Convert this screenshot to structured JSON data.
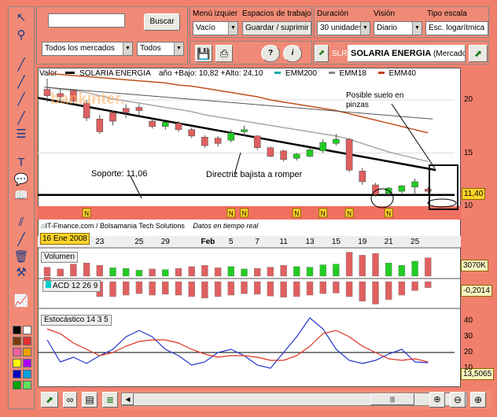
{
  "search": {
    "value": "",
    "button": "Buscar",
    "markets": "Todos los mercados",
    "filter": "Todos"
  },
  "menu": {
    "left_label": "Menú izquier",
    "left_value": "Vacío",
    "spaces_label": "Espacios de trabajo",
    "spaces_value": "Guardar / suprimir",
    "duration_label": "Duración",
    "duration_value": "30 unidades",
    "vision_label": "Visión",
    "vision_value": "Diario",
    "scale_label": "Tipo escala",
    "scale_value": "Esc. logarítmica"
  },
  "ticker": {
    "code": "SLR",
    "name": "SOLARIA ENERGIA",
    "market": "(Mercado"
  },
  "chart_header": {
    "valor": "Valor",
    "name": "SOLARIA ENERGIA",
    "range": "año +Bajo: 10,82 +Alto: 24,10",
    "emm200": "EMM200",
    "emm18": "EMM18",
    "emm40": "EMM40"
  },
  "annotations": {
    "suelo": "Posible suelo en pinzas",
    "soporte": "Soporte: 11,06",
    "directriz": "Directriz bajista a romper"
  },
  "watermark": "bankinter.",
  "footer_source": "IT-Finance.com / Bolsamania Tech Solutions",
  "footer_realtime": "Datos en tiempo real",
  "price_tag": "11,40",
  "date_tag": "16 Ene 2008",
  "x_labels": [
    "23",
    "25",
    "29",
    "Feb",
    "5",
    "7",
    "11",
    "13",
    "15",
    "19",
    "21",
    "25"
  ],
  "price_ticks": [
    "20",
    "15",
    "10"
  ],
  "news_flags": [
    "N",
    "N",
    "N",
    "N",
    "N",
    "N",
    "N"
  ],
  "volume": {
    "title": "Volumen",
    "tag": "3070K"
  },
  "macd": {
    "title": "ACD 12 26 9",
    "tag": "-0,2014"
  },
  "stoch": {
    "title": "Estocástico 14 3 5",
    "tag": "13,5065",
    "ticks": [
      "40",
      "30",
      "20",
      "10"
    ]
  },
  "colors": {
    "up": "#22cc22",
    "down": "#e06060",
    "ema18": "#a8a8a8",
    "ema40": "#c05020",
    "k": "#2233cc",
    "d": "#dd3322",
    "bg": "#f07f6c"
  },
  "tools": [
    "cursor-icon",
    "zoom-icon",
    "line-icon",
    "line-icon",
    "line-icon",
    "line-icon",
    "fib-icon",
    "text-icon",
    "comment-icon",
    "book-icon",
    "parallel-icon",
    "line-icon",
    "trash-icon",
    "tools-icon",
    "chart-icon"
  ],
  "chart_data": [
    {
      "type": "candlestick",
      "x": [
        "2008-01-16",
        "2008-01-17",
        "2008-01-18",
        "2008-01-21",
        "2008-01-22",
        "2008-01-23",
        "2008-01-24",
        "2008-01-25",
        "2008-01-28",
        "2008-01-29",
        "2008-01-30",
        "2008-01-31",
        "2008-02-01",
        "2008-02-04",
        "2008-02-05",
        "2008-02-06",
        "2008-02-07",
        "2008-02-08",
        "2008-02-11",
        "2008-02-12",
        "2008-02-13",
        "2008-02-14",
        "2008-02-15",
        "2008-02-18",
        "2008-02-19",
        "2008-02-20",
        "2008-02-21",
        "2008-02-22",
        "2008-02-25",
        "2008-02-26"
      ],
      "open": [
        21.0,
        20.6,
        20.9,
        19.7,
        18.2,
        18.8,
        19.2,
        19.3,
        18.0,
        17.5,
        17.8,
        17.2,
        16.5,
        16.4,
        16.2,
        17.0,
        16.6,
        15.5,
        15.2,
        14.5,
        14.7,
        15.2,
        15.9,
        16.3,
        13.3,
        12.0,
        11.2,
        11.4,
        11.8,
        11.6
      ],
      "close": [
        20.4,
        20.3,
        19.9,
        18.3,
        17.0,
        18.0,
        18.8,
        19.0,
        17.5,
        17.9,
        17.2,
        16.6,
        15.7,
        15.9,
        16.9,
        17.2,
        15.5,
        14.7,
        14.4,
        14.9,
        15.3,
        16.0,
        16.3,
        13.4,
        12.3,
        11.1,
        11.7,
        11.9,
        12.3,
        11.4
      ],
      "high": [
        22.0,
        21.0,
        21.0,
        20.0,
        18.6,
        19.0,
        19.6,
        19.6,
        18.2,
        17.9,
        18.0,
        17.4,
        16.7,
        16.6,
        17.2,
        17.6,
        16.7,
        15.6,
        15.3,
        15.0,
        15.5,
        16.3,
        16.8,
        16.4,
        13.6,
        12.2,
        11.8,
        12.0,
        12.6,
        11.8
      ],
      "low": [
        19.8,
        19.8,
        19.6,
        18.0,
        16.8,
        17.6,
        18.3,
        18.6,
        17.3,
        17.2,
        17.0,
        16.4,
        15.5,
        15.6,
        16.0,
        16.6,
        15.3,
        14.6,
        14.2,
        14.3,
        14.6,
        15.0,
        15.7,
        13.2,
        12.0,
        10.9,
        10.9,
        11.2,
        11.1,
        11.2
      ],
      "ema18": [
        21.2,
        21.0,
        20.9,
        20.7,
        20.4,
        20.1,
        19.9,
        19.7,
        19.5,
        19.3,
        19.1,
        18.9,
        18.6,
        18.4,
        18.2,
        18.0,
        17.8,
        17.6,
        17.4,
        17.2,
        17.0,
        16.8,
        16.6,
        16.3,
        15.9,
        15.5,
        15.1,
        14.8,
        14.5,
        14.2
      ],
      "ema40": [
        22.5,
        22.4,
        22.3,
        22.2,
        22.1,
        22.0,
        21.9,
        21.8,
        21.7,
        21.6,
        21.4,
        21.3,
        21.1,
        20.9,
        20.7,
        20.5,
        20.3,
        20.0,
        19.8,
        19.6,
        19.4,
        19.2,
        19.0,
        18.7,
        18.4,
        18.1,
        17.8,
        17.5,
        17.2,
        16.9
      ],
      "support": 11.06,
      "ylim": [
        10,
        22
      ],
      "ylabel": "Valor"
    },
    {
      "type": "bar",
      "title": "Volumen",
      "values": [
        1.5,
        1.2,
        2.0,
        2.2,
        1.8,
        1.4,
        1.3,
        1.0,
        1.2,
        1.1,
        1.3,
        1.6,
        1.8,
        1.4,
        1.6,
        1.2,
        1.3,
        1.5,
        1.8,
        1.6,
        1.5,
        1.9,
        2.0,
        4.0,
        3.5,
        3.8,
        2.2,
        1.8,
        2.5,
        3.07
      ],
      "up": [
        false,
        false,
        false,
        false,
        false,
        true,
        true,
        true,
        false,
        true,
        false,
        false,
        false,
        false,
        true,
        true,
        false,
        false,
        false,
        true,
        true,
        true,
        true,
        false,
        false,
        false,
        true,
        true,
        true,
        false
      ]
    },
    {
      "type": "bar",
      "title": "ACD 12 26 9",
      "values": [
        0.15,
        0.05,
        -0.1,
        -0.3,
        -0.5,
        -0.5,
        -0.45,
        -0.4,
        -0.45,
        -0.42,
        -0.45,
        -0.5,
        -0.55,
        -0.5,
        -0.45,
        -0.4,
        -0.42,
        -0.48,
        -0.52,
        -0.5,
        -0.45,
        -0.4,
        -0.38,
        -0.5,
        -0.65,
        -0.75,
        -0.6,
        -0.45,
        -0.3,
        -0.2
      ]
    },
    {
      "type": "line",
      "title": "Estocástico 14 3 5",
      "series": [
        {
          "name": "K",
          "values": [
            28,
            14,
            17,
            13,
            18,
            22,
            30,
            34,
            30,
            22,
            18,
            12,
            14,
            20,
            22,
            18,
            12,
            10,
            20,
            30,
            42,
            35,
            22,
            15,
            13,
            15,
            19,
            22,
            14,
            13.5
          ]
        },
        {
          "name": "D",
          "values": [
            35,
            32,
            26,
            22,
            18,
            20,
            24,
            27,
            28,
            28,
            26,
            22,
            19,
            17,
            18,
            18,
            17,
            15,
            15,
            18,
            24,
            32,
            34,
            30,
            24,
            20,
            16,
            15,
            16,
            14
          ]
        }
      ],
      "ylim": [
        0,
        45
      ]
    }
  ]
}
